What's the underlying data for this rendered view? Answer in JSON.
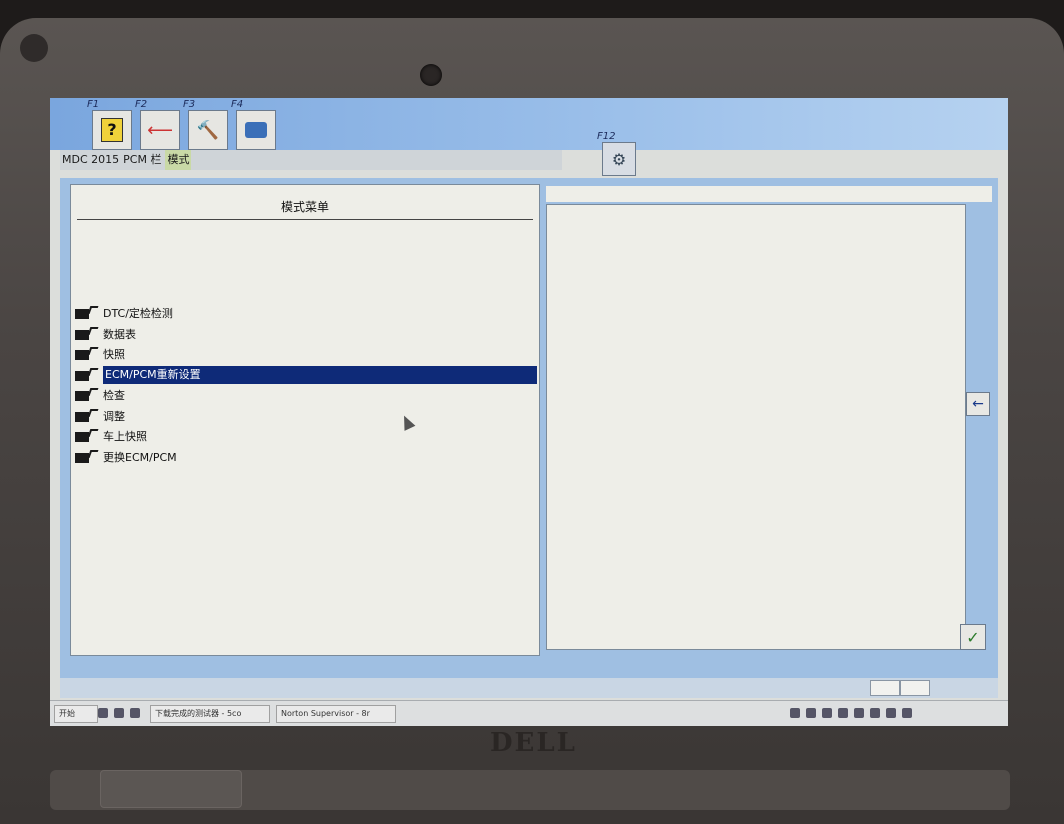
{
  "device": {
    "brand": "DELL"
  },
  "toolbar": {
    "buttons": [
      {
        "fkey": "F1",
        "icon": "help-icon"
      },
      {
        "fkey": "F2",
        "icon": "back-arrow-icon"
      },
      {
        "fkey": "F3",
        "icon": "tool-icon"
      },
      {
        "fkey": "F4",
        "icon": "print-icon"
      }
    ],
    "right_button": {
      "fkey": "F12",
      "icon": "settings-icon"
    }
  },
  "breadcrumb": {
    "items": [
      "MDC 2015",
      "PCM 栏"
    ],
    "active": "模式"
  },
  "menu": {
    "title": "模式菜单",
    "items": [
      "DTC/定检检测",
      "数据表",
      "快照",
      "ECM/PCM重新设置",
      "检查",
      "调整",
      "车上快照",
      "更换ECM/PCM"
    ],
    "selected_index": 3
  },
  "buttons": {
    "back_glyph": "←",
    "ok_glyph": "✓"
  },
  "taskbar": {
    "start": "开始",
    "tasks": [
      "下载完成的测试器 - 5co",
      "Norton Supervisor - 8r"
    ]
  },
  "colors": {
    "selection": "#0e2a78",
    "workspace": "#9fbfe2",
    "toolbar": "#7aa6de"
  }
}
